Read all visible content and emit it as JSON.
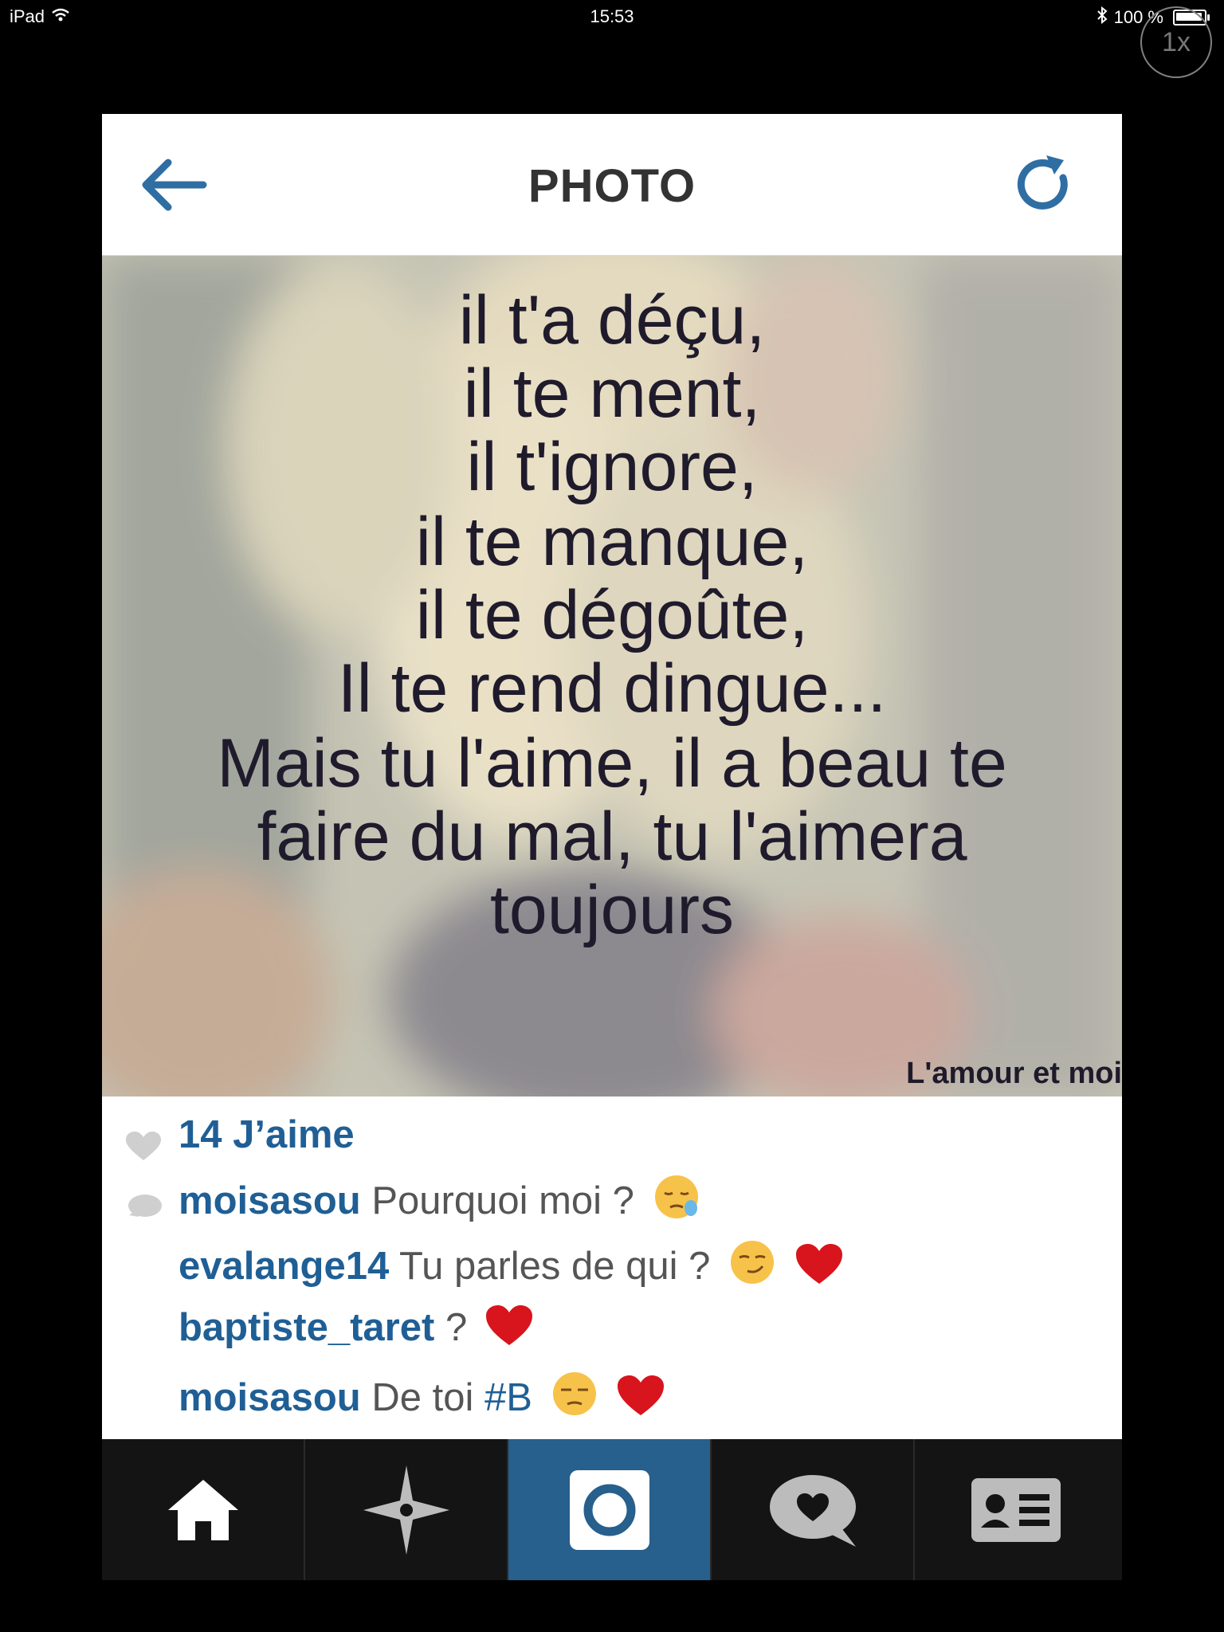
{
  "status_bar": {
    "device": "iPad",
    "time": "15:53",
    "battery": "100 %",
    "zoom": "1x"
  },
  "nav": {
    "title": "PHOTO",
    "back_icon": "arrow-left-icon",
    "refresh_icon": "refresh-icon",
    "accent": "#2f6ea3"
  },
  "photo": {
    "lines": [
      "il t'a déçu,",
      "il te ment,",
      "il t'ignore,",
      "il te manque,",
      "il te dégoûte,",
      "Il te rend dingue...",
      "Mais tu l'aime, il a beau te",
      "faire du mal, tu l'aimera",
      "toujours"
    ],
    "watermark": "L'amour et moi"
  },
  "likes": {
    "text": "14 J’aime",
    "icon": "heart-icon"
  },
  "comments": [
    {
      "user": "moisasou",
      "text": "Pourquoi moi ?",
      "emoji": "sleepy-face"
    },
    {
      "user": "evalange14",
      "text": "Tu parles de qui ?",
      "emoji": "smirk-face-heart"
    },
    {
      "user": "baptiste_taret",
      "text": "?",
      "emoji": "red-heart"
    },
    {
      "user": "moisasou",
      "text": "De toi",
      "tag": "#B",
      "emoji": "unamused-face-heart"
    }
  ],
  "tabs": [
    {
      "name": "home",
      "icon": "home-icon"
    },
    {
      "name": "explore",
      "icon": "compass-star-icon"
    },
    {
      "name": "camera",
      "icon": "camera-icon",
      "active": true
    },
    {
      "name": "activity",
      "icon": "heart-bubble-icon"
    },
    {
      "name": "profile",
      "icon": "profile-card-icon"
    }
  ],
  "colors": {
    "link": "#1f5f95",
    "active_tab": "#275f8d",
    "tab_bar": "#141414"
  }
}
